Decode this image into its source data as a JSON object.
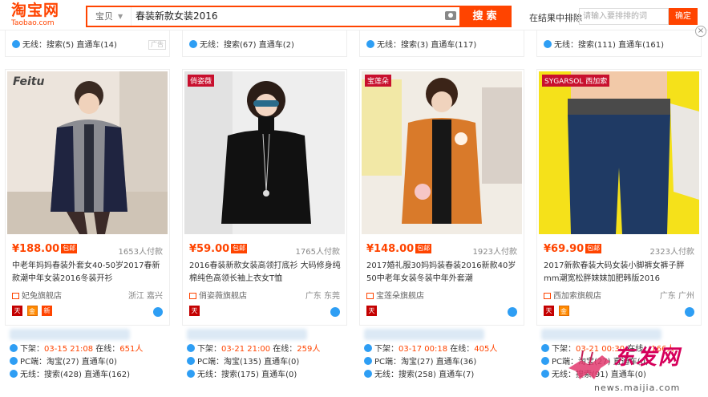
{
  "header": {
    "logo_cn": "淘宝网",
    "logo_en": "Taobao.com",
    "search_type": "宝贝",
    "search_query": "春装新款女装2016",
    "search_button": "搜索",
    "filter_label": "在结果中排除",
    "filter_placeholder": "请输入要排排的词",
    "filter_button": "确定",
    "accent_color": "#ff4400"
  },
  "top_row": [
    {
      "wx": "无线：",
      "search": "搜索(5)",
      "ztc": "直通车(14)",
      "ad": "广告"
    },
    {
      "wx": "无线：",
      "search": "搜索(67)",
      "ztc": "直通车(2)"
    },
    {
      "wx": "无线：",
      "search": "搜索(3)",
      "ztc": "直通车(117)"
    },
    {
      "wx": "无线：",
      "search": "搜索(111)",
      "ztc": "直通车(161)"
    }
  ],
  "products": [
    {
      "brand_tag": "Feitu",
      "price": "¥188.00",
      "baoyou": "包邮",
      "sold": "1653人付款",
      "title": "中老年妈妈春装外套女40-50岁2017春新款潮中年女装2016冬装开衫",
      "shop": "妃兔旗舰店",
      "location": "浙江 嘉兴",
      "badges": [
        "tmall",
        "jin",
        "xin"
      ],
      "stats": {
        "xiajia_label": "下架：",
        "xiajia": "03-15 21:08",
        "online_label": "在线：",
        "online": "651人",
        "pc_label": "PC端：",
        "pc_tb": "淘宝(27)",
        "pc_ztc": "直通车(0)",
        "wx_label": "无线：",
        "wx_search": "搜索(428)",
        "wx_ztc": "直通车(162)"
      }
    },
    {
      "brand_tag": "俏姿薇",
      "price": "¥59.00",
      "baoyou": "包邮",
      "sold": "1765人付款",
      "title": "2016春装新款女装高领打底衫 大码修身纯棉纯色高领长袖上衣女T恤",
      "shop": "俏姿薇旗舰店",
      "location": "广东 东莞",
      "badges": [
        "tmall"
      ],
      "stats": {
        "xiajia_label": "下架：",
        "xiajia": "03-21 21:00",
        "online_label": "在线：",
        "online": "259人",
        "pc_label": "PC端：",
        "pc_tb": "淘宝(135)",
        "pc_ztc": "直通车(0)",
        "wx_label": "无线：",
        "wx_search": "搜索(175)",
        "wx_ztc": "直通车(0)"
      }
    },
    {
      "brand_tag": "宝莲朵",
      "price": "¥148.00",
      "baoyou": "包邮",
      "sold": "1923人付款",
      "title": "2017婚礼服30妈妈装春装2016新款40岁50中老年女装冬装中年外套潮",
      "shop": "宝莲朵旗舰店",
      "location": "",
      "badges": [
        "tmall"
      ],
      "stats": {
        "xiajia_label": "下架：",
        "xiajia": "03-17 00:18",
        "online_label": "在线：",
        "online": "405人",
        "pc_label": "PC端：",
        "pc_tb": "淘宝(27)",
        "pc_ztc": "直通车(36)",
        "wx_label": "无线：",
        "wx_search": "搜索(258)",
        "wx_ztc": "直通车(7)"
      }
    },
    {
      "brand_tag": "SYGARSOL 西加索",
      "price": "¥69.90",
      "baoyou": "包邮",
      "sold": "2323人付款",
      "title": "2017新款春装大码女装小脚裤女裤子胖mm潮宽松胖妹妹加肥韩版2016",
      "shop": "西加索旗舰店",
      "location": "广东 广州",
      "badges": [
        "tmall",
        "jin"
      ],
      "stats": {
        "xiajia_label": "下架：",
        "xiajia": "03-21 00:30",
        "online_label": "在线：",
        "online": "166人",
        "pc_label": "PC端：",
        "pc_tb": "淘宝(27)",
        "pc_ztc": "直通车(0)",
        "wx_label": "无线：",
        "wx_search": "搜索(91)",
        "wx_ztc": "直通车(0)"
      }
    }
  ],
  "watermark": {
    "text": "东发网",
    "url": "news.maijia.com"
  }
}
